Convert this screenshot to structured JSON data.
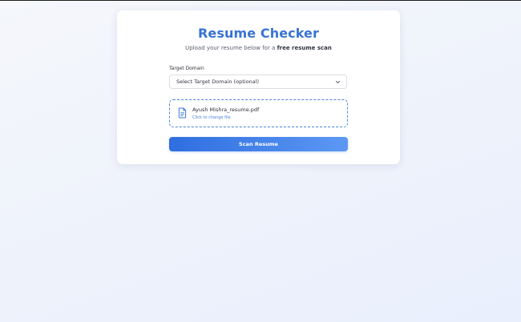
{
  "header": {
    "title": "Resume Checker",
    "subtitle_prefix": "Upload your resume below for a ",
    "subtitle_emphasis": "free resume scan"
  },
  "form": {
    "domain_label": "Target Domain",
    "domain_select": {
      "selected": "Select Target Domain (optional)"
    },
    "upload": {
      "file_name": "Ayush Mishra_resume.pdf",
      "hint": "Click to change file"
    },
    "submit_label": "Scan Resume"
  },
  "icons": {
    "file": "file-document-icon",
    "chevron": "chevron-down-icon"
  },
  "colors": {
    "accent": "#3874d2",
    "dropzone_border": "#4a82d8",
    "button_start": "#2f6ee0",
    "button_end": "#5c98f3"
  }
}
